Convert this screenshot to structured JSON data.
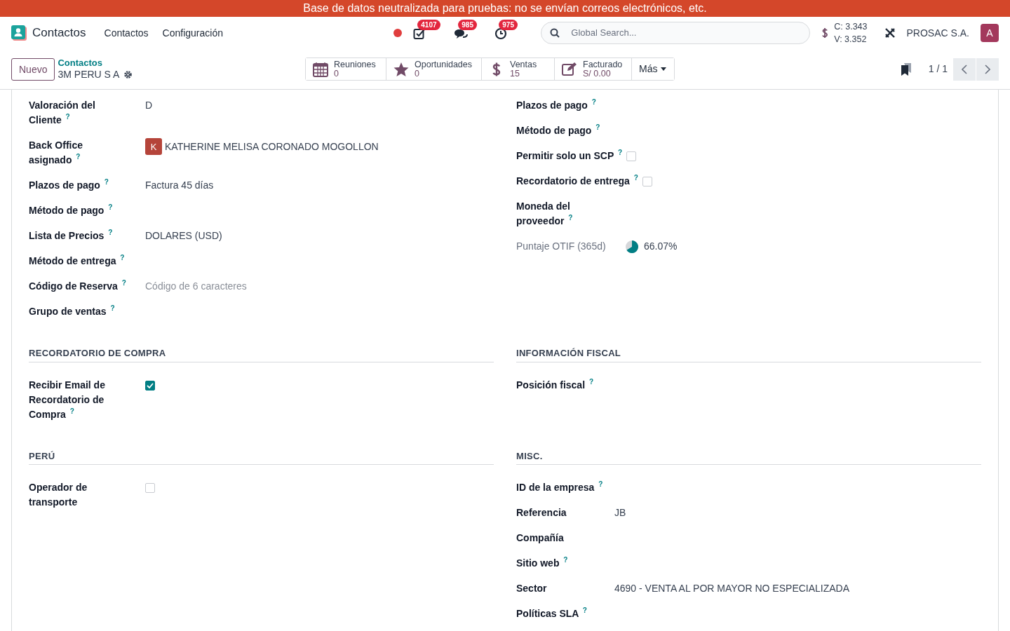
{
  "banner": "Base de datos neutralizada para pruebas: no se envían correos electrónicos, etc.",
  "navbar": {
    "app_name": "Contactos",
    "menu": [
      "Contactos",
      "Configuración"
    ],
    "recording": true,
    "indicators": [
      {
        "kind": "activity",
        "count": "4107"
      },
      {
        "kind": "messages",
        "count": "985"
      },
      {
        "kind": "clock",
        "count": "975"
      }
    ],
    "search": {
      "placeholder": "Global Search..."
    },
    "rates": [
      "C: 3.343",
      "V: 3.352"
    ],
    "company": "PROSAC S.A.",
    "user_initial": "A"
  },
  "control_panel": {
    "new_button": "Nuevo",
    "breadcrumb": "Contactos",
    "record": "3M PERU S A",
    "smart_buttons": [
      {
        "kind": "calendar",
        "label": "Reuniones",
        "value": "0"
      },
      {
        "kind": "star",
        "label": "Oportunidades",
        "value": "0"
      },
      {
        "kind": "dollar",
        "label": "Ventas",
        "value": "15"
      },
      {
        "kind": "edit",
        "label": "Facturado",
        "value": "S/ 0.00"
      }
    ],
    "more": "Más",
    "pager": "1 / 1"
  },
  "rows": [
    {
      "left": {
        "fields": [
          {
            "kind": "text",
            "label": "Valoración del Cliente",
            "help": "?",
            "value": "D"
          },
          {
            "kind": "user",
            "label": "Back Office asignado",
            "help": "?",
            "value": "KATHERINE MELISA CORONADO MOGOLLON",
            "initial": "K",
            "color": "#b5443a"
          },
          {
            "kind": "text",
            "label": "Plazos de pago",
            "help": "?",
            "value": "Factura 45 días"
          },
          {
            "kind": "text",
            "label": "Método de pago",
            "help": "?"
          },
          {
            "kind": "text",
            "label": "Lista de Precios",
            "help": "?",
            "value": "DOLARES (USD)"
          },
          {
            "kind": "text",
            "label": "Método de entrega",
            "help": "?"
          },
          {
            "kind": "text",
            "label": "Código de Reserva",
            "help": "?",
            "placeholder": "Código de 6 caracteres"
          },
          {
            "kind": "text",
            "label": "Grupo de ventas",
            "help": "?"
          }
        ]
      },
      "right": {
        "fields": [
          {
            "kind": "text",
            "label": "Plazos de pago",
            "help": "?"
          },
          {
            "kind": "text",
            "label": "Método de pago",
            "help": "?"
          },
          {
            "kind": "checkbox",
            "label": "Permitir solo un SCP",
            "help": "?",
            "checked": false
          },
          {
            "kind": "checkbox",
            "label": "Recordatorio de entrega",
            "help": "?",
            "checked": false
          },
          {
            "kind": "text",
            "label": "Moneda del proveedor",
            "help": "?"
          },
          {
            "kind": "pie",
            "label": "Puntaje OTIF (365d)",
            "muted": true,
            "level": 0.6607,
            "value": "66.07%"
          }
        ]
      }
    },
    {
      "left": {
        "title": "RECORDATORIO DE COMPRA",
        "fields": [
          {
            "kind": "checkbox",
            "label": "Recibir Email de Recordatorio de Compra",
            "help": "?",
            "checked": true
          }
        ]
      },
      "right": {
        "title": "INFORMACIÓN FISCAL",
        "fields": [
          {
            "kind": "text",
            "label": "Posición fiscal",
            "help": "?"
          }
        ]
      }
    },
    {
      "left": {
        "title": "PERÚ",
        "fields": [
          {
            "kind": "checkbox",
            "label": "Operador de transporte",
            "checked": false
          }
        ]
      },
      "right": {
        "title": "MISC.",
        "fields": [
          {
            "kind": "text",
            "label": "ID de la empresa",
            "help": "?"
          },
          {
            "kind": "text",
            "label": "Referencia",
            "value": "JB"
          },
          {
            "kind": "text",
            "label": "Compañía"
          },
          {
            "kind": "text",
            "label": "Sitio web",
            "help": "?"
          },
          {
            "kind": "text",
            "label": "Sector",
            "value": "4690 - VENTA AL POR MAYOR NO ESPECIALIZADA"
          },
          {
            "kind": "text",
            "label": "Políticas SLA",
            "help": "?"
          }
        ]
      }
    }
  ]
}
